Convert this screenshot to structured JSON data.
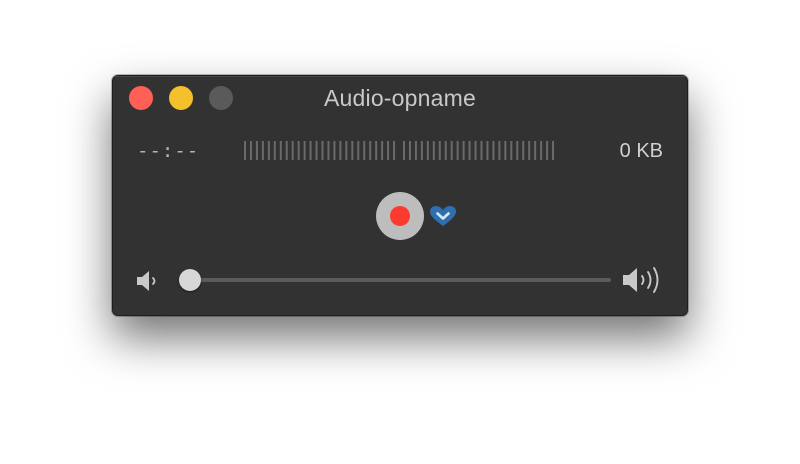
{
  "window": {
    "title": "Audio-opname"
  },
  "recorder": {
    "elapsed_time": "--:--",
    "file_size": "0 KB",
    "level_meter_bar_count": 52
  },
  "volume": {
    "level": 0.0
  },
  "icons": {
    "record": "record-icon",
    "options": "chevron-down-icon",
    "volume_low": "speaker-low-icon",
    "volume_high": "speaker-high-icon"
  },
  "colors": {
    "window_bg": "#323232",
    "close": "#fe5f57",
    "minimize": "#f4c12d",
    "zoom_disabled": "#5a5a5a",
    "record_red": "#fb3b2f",
    "record_button": "#bdbdbd",
    "options_blue": "#2f6fb0"
  }
}
